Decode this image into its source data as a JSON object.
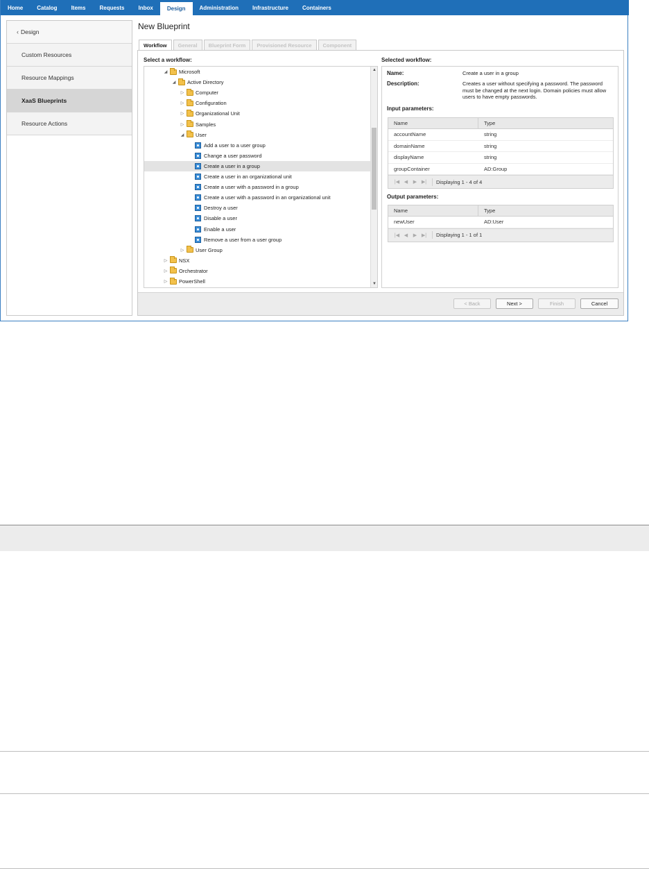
{
  "topnav": {
    "tabs": [
      "Home",
      "Catalog",
      "Items",
      "Requests",
      "Inbox",
      "Design",
      "Administration",
      "Infrastructure",
      "Containers"
    ],
    "active": "Design"
  },
  "sidebar": {
    "back_label": "Design",
    "items": [
      {
        "label": "Custom Resources",
        "active": false
      },
      {
        "label": "Resource Mappings",
        "active": false
      },
      {
        "label": "XaaS Blueprints",
        "active": true
      },
      {
        "label": "Resource Actions",
        "active": false
      }
    ]
  },
  "page": {
    "title": "New Blueprint"
  },
  "wizard": {
    "tabs": [
      {
        "label": "Workflow",
        "active": true
      },
      {
        "label": "General",
        "active": false
      },
      {
        "label": "Blueprint Form",
        "active": false
      },
      {
        "label": "Provisioned Resource",
        "active": false
      },
      {
        "label": "Component",
        "active": false
      }
    ],
    "select_label": "Select a workflow:",
    "selected_label": "Selected workflow:",
    "tree": [
      {
        "label": "Microsoft",
        "type": "folder",
        "level": 0,
        "expanded": true
      },
      {
        "label": "Active Directory",
        "type": "folder",
        "level": 1,
        "expanded": true
      },
      {
        "label": "Computer",
        "type": "folder",
        "level": 2,
        "expanded": false
      },
      {
        "label": "Configuration",
        "type": "folder",
        "level": 2,
        "expanded": false
      },
      {
        "label": "Organizational Unit",
        "type": "folder",
        "level": 2,
        "expanded": false
      },
      {
        "label": "Samples",
        "type": "folder",
        "level": 2,
        "expanded": false
      },
      {
        "label": "User",
        "type": "folder",
        "level": 2,
        "expanded": true
      },
      {
        "label": "Add a user to a user group",
        "type": "workflow",
        "level": 3
      },
      {
        "label": "Change a user password",
        "type": "workflow",
        "level": 3
      },
      {
        "label": "Create a user in a group",
        "type": "workflow",
        "level": 3,
        "selected": true
      },
      {
        "label": "Create a user in an organizational unit",
        "type": "workflow",
        "level": 3
      },
      {
        "label": "Create a user with a password in a group",
        "type": "workflow",
        "level": 3
      },
      {
        "label": "Create a user with a password in an organizational unit",
        "type": "workflow",
        "level": 3
      },
      {
        "label": "Destroy a user",
        "type": "workflow",
        "level": 3
      },
      {
        "label": "Disable a user",
        "type": "workflow",
        "level": 3
      },
      {
        "label": "Enable a user",
        "type": "workflow",
        "level": 3
      },
      {
        "label": "Remove a user from a user group",
        "type": "workflow",
        "level": 3
      },
      {
        "label": "User Group",
        "type": "folder",
        "level": 2,
        "expanded": false
      },
      {
        "label": "NSX",
        "type": "folder",
        "level": 0,
        "expanded": false
      },
      {
        "label": "Orchestrator",
        "type": "folder",
        "level": 0,
        "expanded": false
      },
      {
        "label": "PowerShell",
        "type": "folder",
        "level": 0,
        "expanded": false
      }
    ],
    "details": {
      "name_label": "Name:",
      "name_value": "Create a user in a group",
      "description_label": "Description:",
      "description_value": "Creates a user without specifying a password. The password must be changed at the next login. Domain policies must allow users to have empty passwords.",
      "input_label": "Input parameters:",
      "output_label": "Output parameters:",
      "col_name": "Name",
      "col_type": "Type",
      "inputs": [
        {
          "name": "accountName",
          "type": "string"
        },
        {
          "name": "domainName",
          "type": "string"
        },
        {
          "name": "displayName",
          "type": "string"
        },
        {
          "name": "groupContainer",
          "type": "AD:Group"
        }
      ],
      "inputs_paging": "Displaying 1 - 4 of 4",
      "outputs": [
        {
          "name": "newUser",
          "type": "AD:User"
        }
      ],
      "outputs_paging": "Displaying 1 - 1 of 1"
    },
    "buttons": {
      "back": "< Back",
      "next": "Next >",
      "finish": "Finish",
      "cancel": "Cancel"
    }
  }
}
